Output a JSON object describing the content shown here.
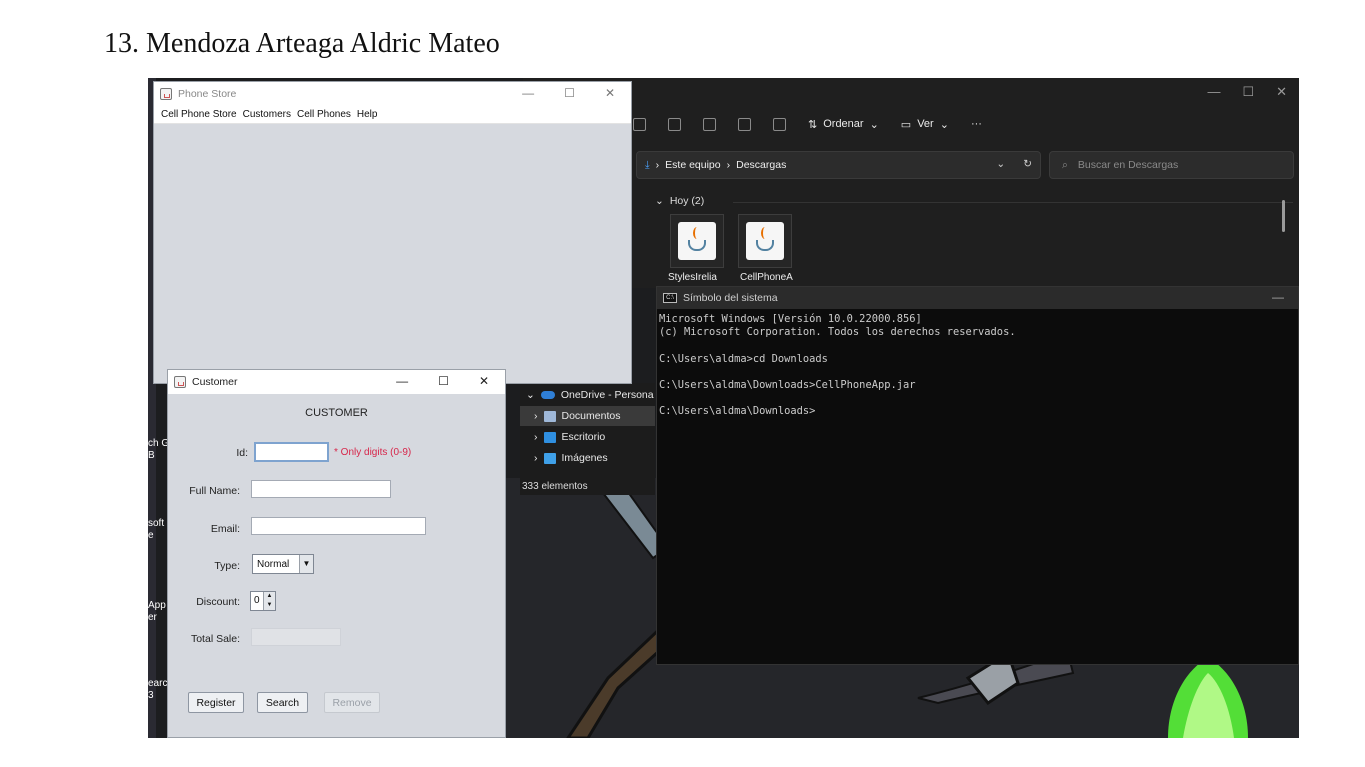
{
  "document": {
    "heading": "13. Mendoza Arteaga Aldric Mateo"
  },
  "desktop": {
    "labels": [
      "ch G",
      "B",
      "soft",
      "e",
      "App",
      "er",
      "earc",
      "3"
    ]
  },
  "explorer": {
    "toolbar": {
      "sort_label": "Ordenar",
      "view_label": "Ver",
      "more_label": "···"
    },
    "address": {
      "parts": [
        "Este equipo",
        "Descargas"
      ],
      "separator": "›"
    },
    "search": {
      "placeholder": "Buscar en Descargas"
    },
    "group": {
      "label": "Hoy (2)"
    },
    "files": [
      {
        "name": "StylesIrelia"
      },
      {
        "name": "CellPhoneA"
      }
    ],
    "nav": {
      "items": [
        {
          "label": "OneDrive - Persona"
        },
        {
          "label": "Documentos"
        },
        {
          "label": "Escritorio"
        },
        {
          "label": "Imágenes"
        }
      ],
      "status": "333 elementos"
    }
  },
  "cmd": {
    "title": "Símbolo del sistema",
    "icon_text": "C:\\",
    "lines": [
      "Microsoft Windows [Versión 10.0.22000.856]",
      "(c) Microsoft Corporation. Todos los derechos reservados.",
      "",
      "C:\\Users\\aldma>cd Downloads",
      "",
      "C:\\Users\\aldma\\Downloads>CellPhoneApp.jar",
      "",
      "C:\\Users\\aldma\\Downloads>"
    ]
  },
  "phone_store": {
    "title": "Phone Store",
    "menu": [
      "Cell Phone Store",
      "Customers",
      "Cell Phones",
      "Help"
    ]
  },
  "customer": {
    "title": "Customer",
    "heading": "CUSTOMER",
    "labels": {
      "id": "Id:",
      "full_name": "Full Name:",
      "email": "Email:",
      "type": "Type:",
      "discount": "Discount:",
      "total_sale": "Total Sale:"
    },
    "id_hint": "* Only digits (0-9)",
    "values": {
      "id": "",
      "full_name": "",
      "email": "",
      "type": "Normal",
      "discount": "0",
      "total_sale": ""
    },
    "buttons": {
      "register": "Register",
      "search": "Search",
      "remove": "Remove"
    }
  },
  "colors": {
    "hint_red": "#d7264a",
    "java_swing_bg": "#d6d9df",
    "cmd_bg": "#0c0c0c",
    "explorer_bg": "#1f1f1f",
    "wallpaper_green": "#5cff3a"
  }
}
